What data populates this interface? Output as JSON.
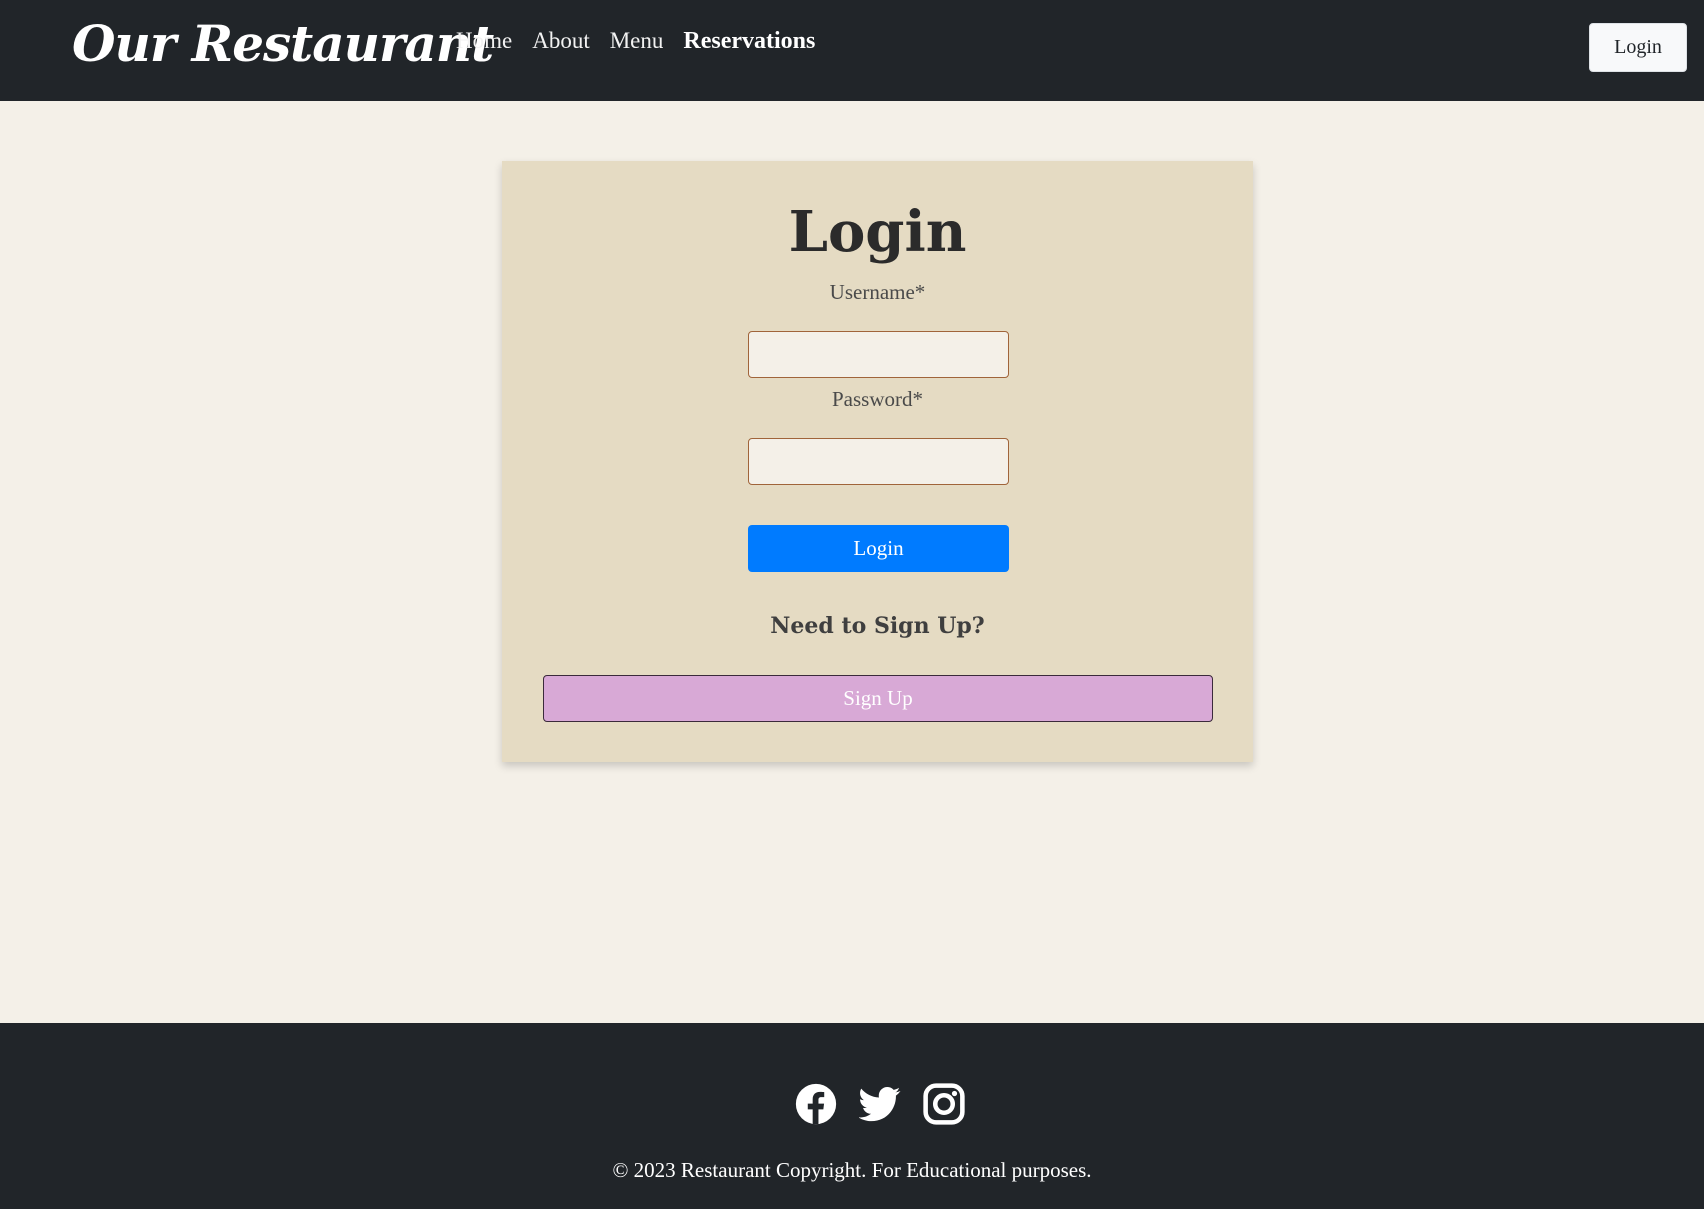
{
  "navbar": {
    "brand": "Our Restaurant",
    "links": [
      "Home",
      "About",
      "Menu",
      "Reservations"
    ],
    "active_link": "Reservations",
    "login_label": "Login"
  },
  "login_card": {
    "title": "Login",
    "username_label": "Username*",
    "username_value": "",
    "password_label": "Password*",
    "password_value": "",
    "submit_label": "Login",
    "signup_prompt": "Need to Sign Up?",
    "signup_label": "Sign Up"
  },
  "footer": {
    "social_icons": [
      "facebook-icon",
      "twitter-icon",
      "instagram-icon"
    ],
    "copyright": "© 2023 Restaurant Copyright. For Educational purposes."
  },
  "colors": {
    "navbar_bg": "#212529",
    "page_bg": "#f4f0e8",
    "card_bg": "#e5dbc3",
    "login_button": "#007bff",
    "signup_button": "#d8a9d6"
  }
}
